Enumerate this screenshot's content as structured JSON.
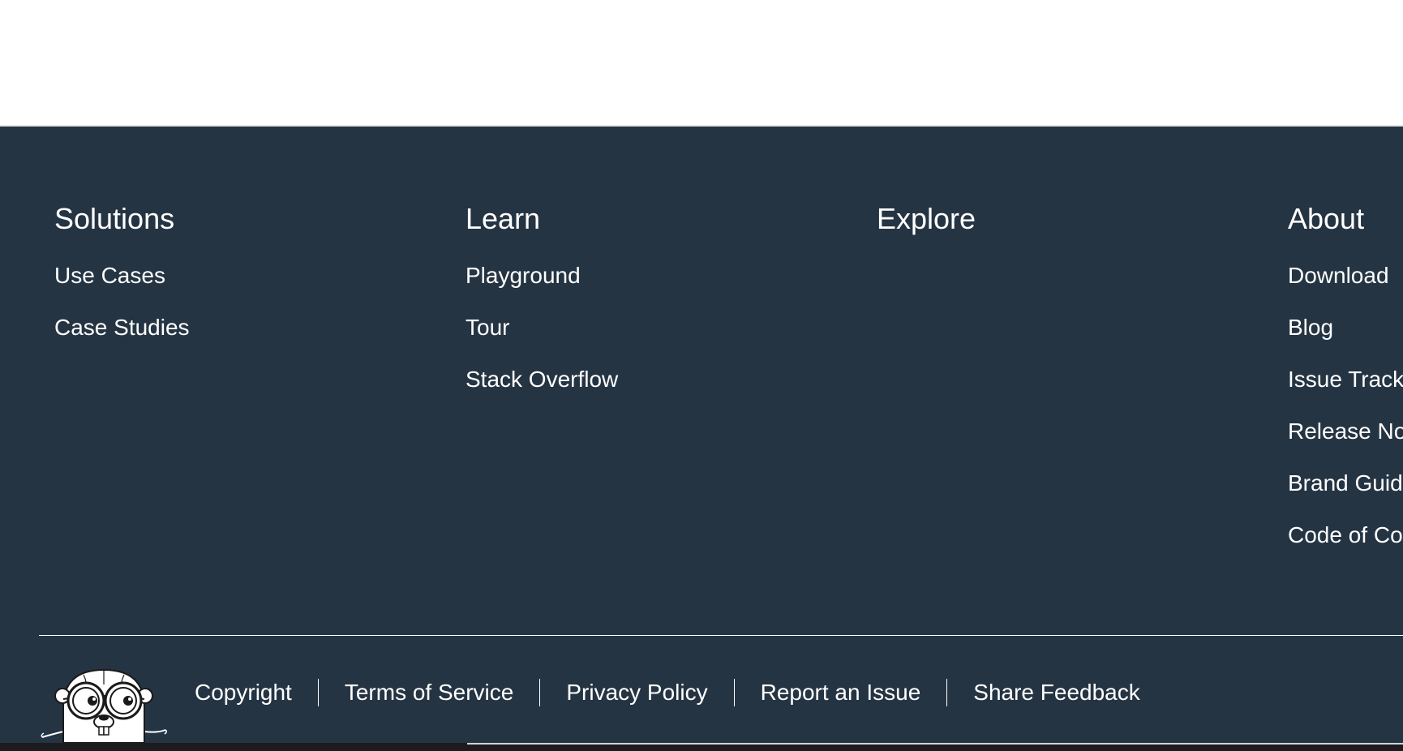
{
  "footer": {
    "columns": [
      {
        "title": "Solutions",
        "links": [
          "Use Cases",
          "Case Studies"
        ]
      },
      {
        "title": "Learn",
        "links": [
          "Playground",
          "Tour",
          "Stack Overflow"
        ]
      },
      {
        "title": "Explore",
        "links": []
      },
      {
        "title": "About",
        "links": [
          "Download",
          "Blog",
          "Issue Track",
          "Release No",
          "Brand Guide",
          "Code of Co"
        ]
      }
    ],
    "legal_links": [
      "Copyright",
      "Terms of Service",
      "Privacy Policy",
      "Report an Issue",
      "Share Feedback"
    ],
    "mascot_icon": "go-gopher-icon",
    "colors": {
      "footer_background": "#253443",
      "text": "#ffffff",
      "page_background": "#ffffff"
    }
  }
}
